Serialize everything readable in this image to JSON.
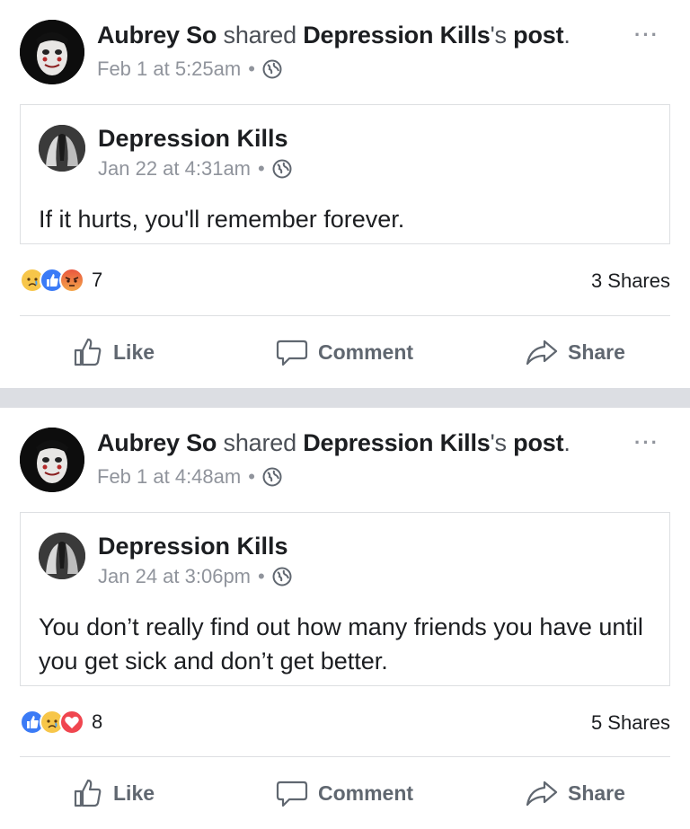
{
  "posts": [
    {
      "author": "Aubrey So",
      "verb": "shared",
      "page_name": "Depression Kills",
      "possessive": "'s",
      "object": "post",
      "period": ".",
      "timestamp": "Feb 1 at 5:25am",
      "more": "···",
      "shared": {
        "name": "Depression Kills",
        "timestamp": "Jan 22 at 4:31am",
        "text": "If it hurts, you'll remember forever."
      },
      "reactions": [
        "sad-reaction",
        "like-reaction",
        "angry-reaction"
      ],
      "reaction_count": "7",
      "shares": "3 Shares",
      "actions": {
        "like": "Like",
        "comment": "Comment",
        "share": "Share"
      }
    },
    {
      "author": "Aubrey So",
      "verb": "shared",
      "page_name": "Depression Kills",
      "possessive": "'s",
      "object": "post",
      "period": ".",
      "timestamp": "Feb 1 at 4:48am",
      "more": "···",
      "shared": {
        "name": "Depression Kills",
        "timestamp": "Jan 24 at 3:06pm",
        "text": "You don’t really find out how many friends you have until you get sick and don’t get better."
      },
      "reactions": [
        "like-reaction",
        "sad-reaction",
        "love-reaction"
      ],
      "reaction_count": "8",
      "shares": "5 Shares",
      "actions": {
        "like": "Like",
        "comment": "Comment",
        "share": "Share"
      }
    }
  ],
  "separator_dot": "•",
  "colors": {
    "text": "#1c1e21",
    "muted": "#90949c",
    "like_blue": "#3b7bf6",
    "love_red": "#f0464f",
    "separator": "#dcdee3"
  }
}
